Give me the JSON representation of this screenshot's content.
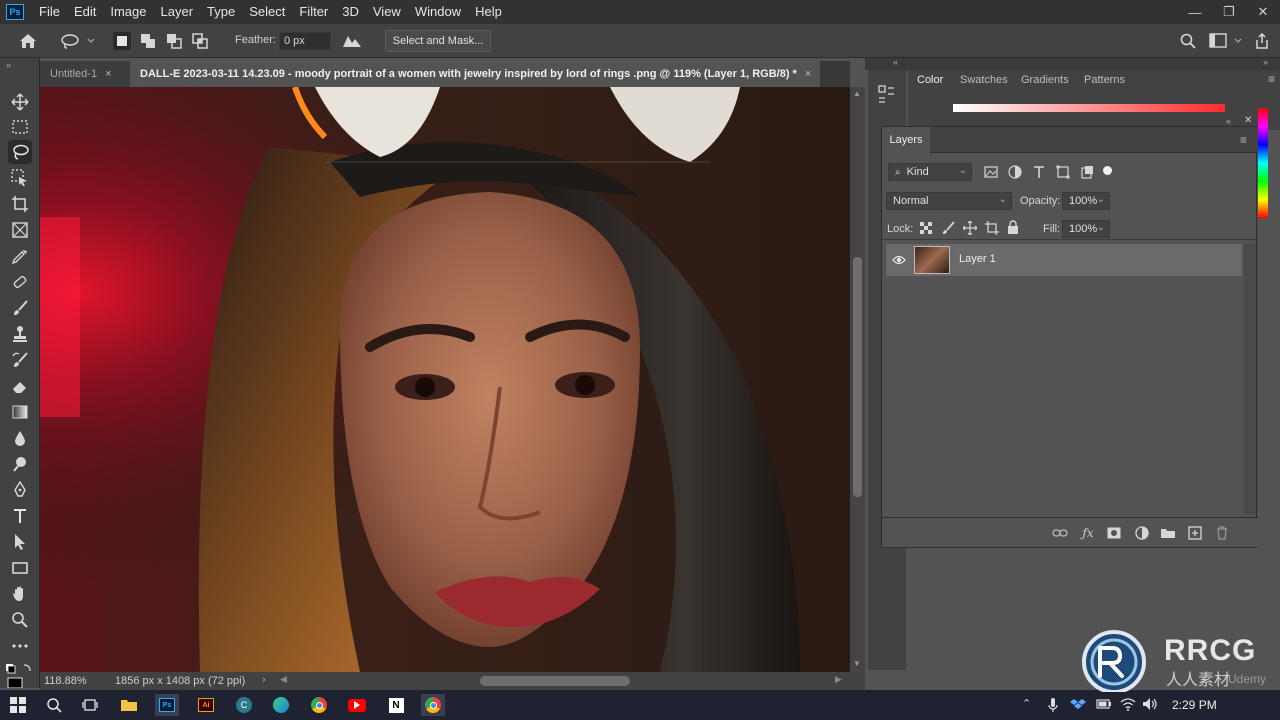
{
  "app": {
    "logo": "Ps"
  },
  "menubar": {
    "items": [
      "File",
      "Edit",
      "Image",
      "Layer",
      "Type",
      "Select",
      "Filter",
      "3D",
      "View",
      "Window",
      "Help"
    ]
  },
  "window_controls": {
    "minimize": "—",
    "restore": "❐",
    "close": "✕"
  },
  "options": {
    "feather_label": "Feather:",
    "feather_value": "0 px",
    "select_mask_label": "Select and Mask..."
  },
  "tabs": [
    {
      "label": "Untitled-1",
      "active": false
    },
    {
      "label": "DALL-E 2023-03-11 14.23.09 - moody portrait of a women with jewelry inspired by lord of rings .png @ 119% (Layer 1, RGB/8) *",
      "active": true
    }
  ],
  "tab_close": "×",
  "status": {
    "zoom": "118.88%",
    "doc_info": "1856 px x 1408 px (72 ppi)",
    "arrow": "›"
  },
  "color_panel": {
    "tabs": [
      "Color",
      "Swatches",
      "Gradients",
      "Patterns"
    ]
  },
  "layers_panel": {
    "title": "Layers",
    "kind_label": "Kind",
    "blend_mode": "Normal",
    "opacity_label": "Opacity:",
    "opacity_value": "100%",
    "lock_label": "Lock:",
    "fill_label": "Fill:",
    "fill_value": "100%",
    "layers": [
      {
        "name": "Layer 1",
        "visible": true
      }
    ]
  },
  "taskbar": {
    "time": "2:29 PM"
  },
  "watermark": {
    "brand": "RRCG",
    "sub": "人人素材",
    "extra": "Udemy"
  }
}
